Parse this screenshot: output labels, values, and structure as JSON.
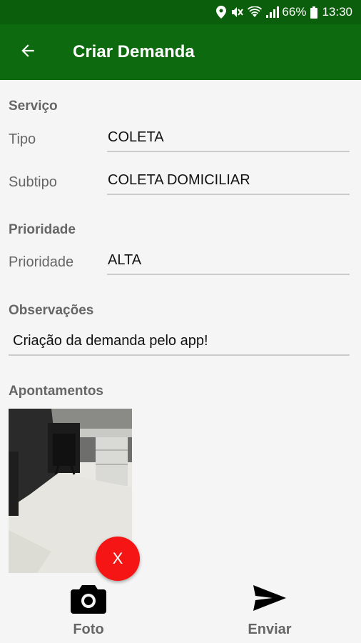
{
  "status_bar": {
    "battery": "66%",
    "time": "13:30",
    "icons": [
      "location-icon",
      "mute-icon",
      "wifi-icon",
      "signal-icon",
      "battery-icon"
    ]
  },
  "app_bar": {
    "title": "Criar Demanda",
    "back_icon": "arrow-back-icon"
  },
  "form": {
    "servico": {
      "section_title": "Serviço",
      "tipo_label": "Tipo",
      "tipo_value": "COLETA",
      "subtipo_label": "Subtipo",
      "subtipo_value": "COLETA DOMICILIAR"
    },
    "prioridade": {
      "section_title": "Prioridade",
      "label": "Prioridade",
      "value": "ALTA"
    },
    "observacoes": {
      "section_title": "Observações",
      "value": "Criação da demanda pelo app!"
    },
    "apontamentos": {
      "section_title": "Apontamentos",
      "remove_label": "X"
    }
  },
  "bottom_bar": {
    "foto_label": "Foto",
    "enviar_label": "Enviar"
  },
  "colors": {
    "status_bar": "#0b5e0b",
    "app_bar": "#0e6a0e",
    "remove_button": "#f51515",
    "label_gray": "#666666"
  }
}
